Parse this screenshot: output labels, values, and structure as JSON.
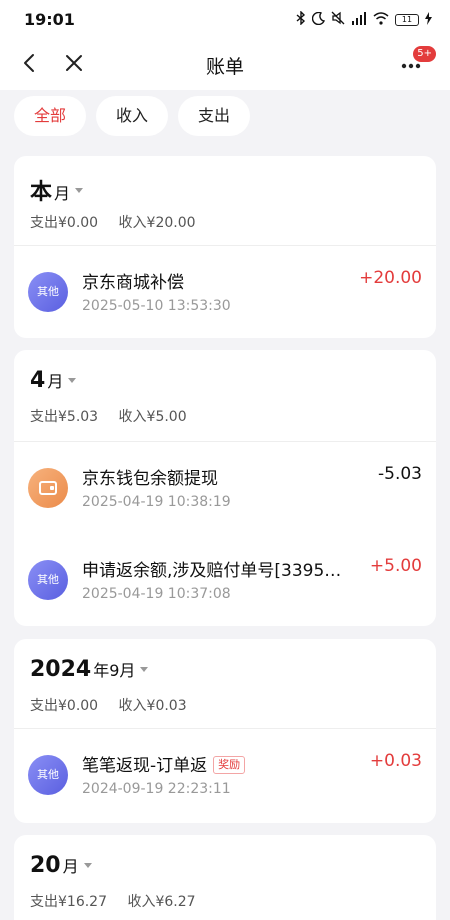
{
  "status_bar": {
    "time": "19:01",
    "battery": "11",
    "icons": [
      "bluetooth-icon",
      "moon-icon",
      "mute-icon",
      "signal-icon",
      "wifi-icon",
      "battery-icon",
      "charging-icon"
    ]
  },
  "nav": {
    "title": "账单",
    "more_badge": "5+"
  },
  "tabs": [
    {
      "label": "全部",
      "active": true
    },
    {
      "label": "收入",
      "active": false
    },
    {
      "label": "支出",
      "active": false
    }
  ],
  "groups": [
    {
      "month_num": "本",
      "month_unit": "月",
      "expense": "支出¥0.00",
      "income": "收入¥20.00",
      "items": [
        {
          "icon": "其他",
          "name": "京东商城补偿",
          "time": "2025-05-10 13:53:30",
          "amount": "+20.00",
          "tag": ""
        }
      ]
    },
    {
      "month_num": "4",
      "month_unit": "月",
      "expense": "支出¥5.03",
      "income": "收入¥5.00",
      "items": [
        {
          "icon": "wallet",
          "name": "京东钱包余额提现",
          "time": "2025-04-19 10:38:19",
          "amount": "-5.03",
          "tag": ""
        },
        {
          "icon": "其他",
          "name": "申请返余额,涉及赔付单号[3395…",
          "time": "2025-04-19 10:37:08",
          "amount": "+5.00",
          "tag": ""
        }
      ]
    },
    {
      "month_num": "2024",
      "month_unit": "年9月",
      "expense": "支出¥0.00",
      "income": "收入¥0.03",
      "items": [
        {
          "icon": "其他",
          "name": "笔笔返现-订单返",
          "time": "2024-09-19 22:23:11",
          "amount": "+0.03",
          "tag": "奖励"
        }
      ]
    },
    {
      "month_num": "20",
      "month_unit": "月",
      "expense": "支出¥16.27",
      "income": "收入¥6.27",
      "items": []
    }
  ],
  "colors": {
    "accent": "#e33c3c",
    "background": "#f3f3f6",
    "avatar_other": "#6b70ea",
    "avatar_wallet": "#f0965a"
  }
}
